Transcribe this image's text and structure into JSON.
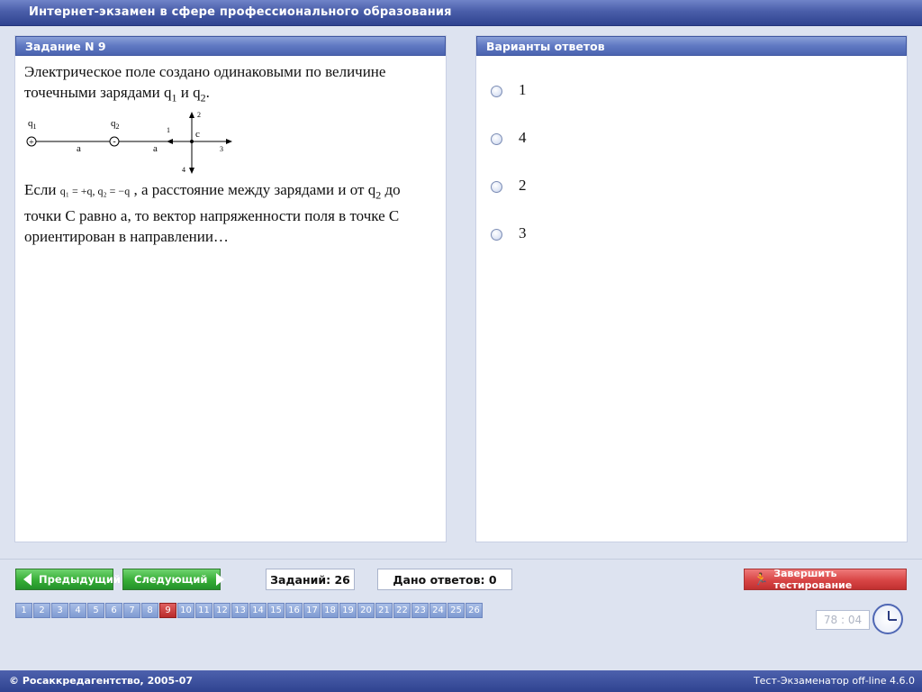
{
  "app": {
    "title": "Интернет-экзамен в сфере профессионального образования"
  },
  "task": {
    "header": "Задание N 9",
    "intro": {
      "text": "Электрическое поле создано одинаковыми по величине точечными зарядами q",
      "sub1": "1",
      "mid": " и q",
      "sub2": "2",
      "end": "."
    },
    "diagram": {
      "q1": "q",
      "q1_sub": "1",
      "q2": "q",
      "q2_sub": "2",
      "plus": "+",
      "minus": "-",
      "a_label": "a",
      "c_label": "c",
      "dir1": "1",
      "dir2": "2",
      "dir3": "3",
      "dir4": "4"
    },
    "condition": {
      "if": "Если ",
      "formula": "q₁ = +q, q₂ = −q",
      "rest1": " , а расстояние между зарядами и от q",
      "sub": "2",
      "rest2": " до точки С равно а, то вектор напряженности поля в точке С ориентирован  в направлении…"
    }
  },
  "answers": {
    "header": "Варианты ответов",
    "options": [
      "1",
      "4",
      "2",
      "3"
    ]
  },
  "nav": {
    "prev_label": "Предыдущий",
    "next_label": "Следующий",
    "tasks_count": "Заданий: 26",
    "answers_given": "Дано ответов: 0",
    "finish_label": "Завершить тестирование",
    "numbers": [
      "1",
      "2",
      "3",
      "4",
      "5",
      "6",
      "7",
      "8",
      "9",
      "10",
      "11",
      "12",
      "13",
      "14",
      "15",
      "16",
      "17",
      "18",
      "19",
      "20",
      "21",
      "22",
      "23",
      "24",
      "25",
      "26"
    ],
    "active_number": "9",
    "timer": "78 : 04"
  },
  "footer": {
    "left": "© Росаккредагентство, 2005-07",
    "right": "Тест-Экзаменатор off-line 4.6.0"
  }
}
